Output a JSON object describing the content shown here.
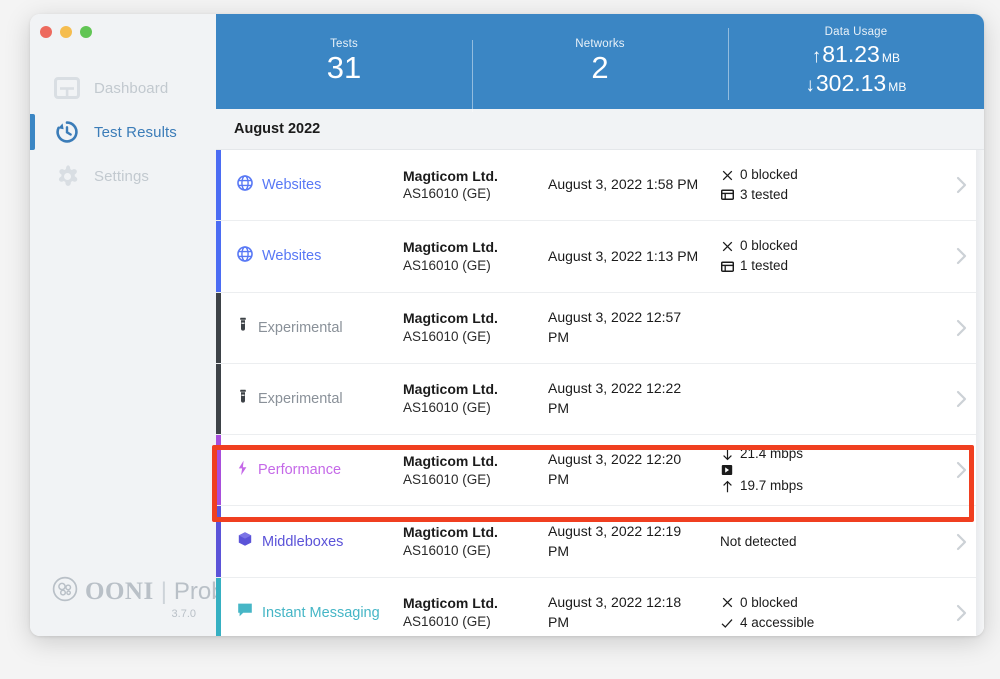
{
  "window": {
    "traffic_lights": [
      "close",
      "minimize",
      "maximize"
    ],
    "colors": {
      "close": "#ed6a5e",
      "minimize": "#f5bd4f",
      "maximize": "#61c554"
    }
  },
  "sidebar": {
    "items": [
      {
        "label": "Dashboard",
        "icon": "dashboard-icon",
        "active": false
      },
      {
        "label": "Test Results",
        "icon": "history-clock-icon",
        "active": true
      },
      {
        "label": "Settings",
        "icon": "gear-icon",
        "active": false
      }
    ],
    "brand": {
      "name": "OONI",
      "separator": "|",
      "product": "Probe",
      "version": "3.7.0",
      "logo_icon": "ooni-logo-icon"
    }
  },
  "header": {
    "accent_color": "#3b86c4",
    "stats": [
      {
        "label": "Tests",
        "value": "31"
      },
      {
        "label": "Networks",
        "value": "2"
      }
    ],
    "data_usage": {
      "label": "Data Usage",
      "upload": {
        "arrow": "↑",
        "value": "81.23",
        "unit": "MB"
      },
      "download": {
        "arrow": "↓",
        "value": "302.13",
        "unit": "MB"
      }
    }
  },
  "month_header": {
    "label": "August 2022"
  },
  "results": [
    {
      "name": "Websites",
      "icon": "globe-icon",
      "accent_class": "ac-websites",
      "name_class": "nm-websites",
      "network": "Magticom Ltd.",
      "asn": "AS16010 (GE)",
      "date": "August 3, 2022 1:58 PM",
      "meta": [
        {
          "icon": "cross-icon",
          "glyph": "×",
          "text": "0 blocked"
        },
        {
          "icon": "web-page-icon",
          "glyph": "⊟",
          "text": "3 tested"
        }
      ],
      "highlighted": false
    },
    {
      "name": "Websites",
      "icon": "globe-icon",
      "accent_class": "ac-websites",
      "name_class": "nm-websites",
      "network": "Magticom Ltd.",
      "asn": "AS16010 (GE)",
      "date": "August 3, 2022 1:13 PM",
      "meta": [
        {
          "icon": "cross-icon",
          "glyph": "×",
          "text": "0 blocked"
        },
        {
          "icon": "web-page-icon",
          "glyph": "⊟",
          "text": "1 tested"
        }
      ],
      "highlighted": false
    },
    {
      "name": "Experimental",
      "icon": "test-tube-icon",
      "accent_class": "ac-experimental",
      "name_class": "nm-experimental",
      "network": "Magticom Ltd.",
      "asn": "AS16010 (GE)",
      "date": "August 3, 2022 12:57 PM",
      "meta": [],
      "highlighted": false
    },
    {
      "name": "Experimental",
      "icon": "test-tube-icon",
      "accent_class": "ac-experimental",
      "name_class": "nm-experimental",
      "network": "Magticom Ltd.",
      "asn": "AS16010 (GE)",
      "date": "August 3, 2022 12:22 PM",
      "meta": [],
      "highlighted": false
    },
    {
      "name": "Performance",
      "icon": "lightning-bolt-icon",
      "accent_class": "ac-performance",
      "name_class": "nm-performance",
      "network": "Magticom Ltd.",
      "asn": "AS16010 (GE)",
      "date": "August 3, 2022 12:20 PM",
      "meta": [
        {
          "icon": "download-arrow-icon",
          "glyph": "↓",
          "text": "21.4 mbps"
        },
        {
          "icon": "video-icon",
          "glyph": "▣",
          "text": ""
        },
        {
          "icon": "upload-arrow-icon",
          "glyph": "↑",
          "text": "19.7 mbps"
        }
      ],
      "highlighted": true
    },
    {
      "name": "Middleboxes",
      "icon": "cube-icon",
      "accent_class": "ac-middleboxes",
      "name_class": "nm-middleboxes",
      "network": "Magticom Ltd.",
      "asn": "AS16010 (GE)",
      "date": "August 3, 2022 12:19 PM",
      "meta": [
        {
          "icon": "none",
          "glyph": "",
          "text": "Not detected"
        }
      ],
      "highlighted": false
    },
    {
      "name": "Instant Messaging",
      "icon": "chat-bubble-icon",
      "accent_class": "ac-im",
      "name_class": "nm-im",
      "network": "Magticom Ltd.",
      "asn": "AS16010 (GE)",
      "date": "August 3, 2022 12:18 PM",
      "meta": [
        {
          "icon": "cross-icon",
          "glyph": "×",
          "text": "0 blocked"
        },
        {
          "icon": "check-icon",
          "glyph": "✓",
          "text": "4 accessible"
        }
      ],
      "highlighted": false
    }
  ],
  "annotation": {
    "color": "#f03f20",
    "target": "Performance"
  },
  "chevron_icon": "chevron-right-icon"
}
